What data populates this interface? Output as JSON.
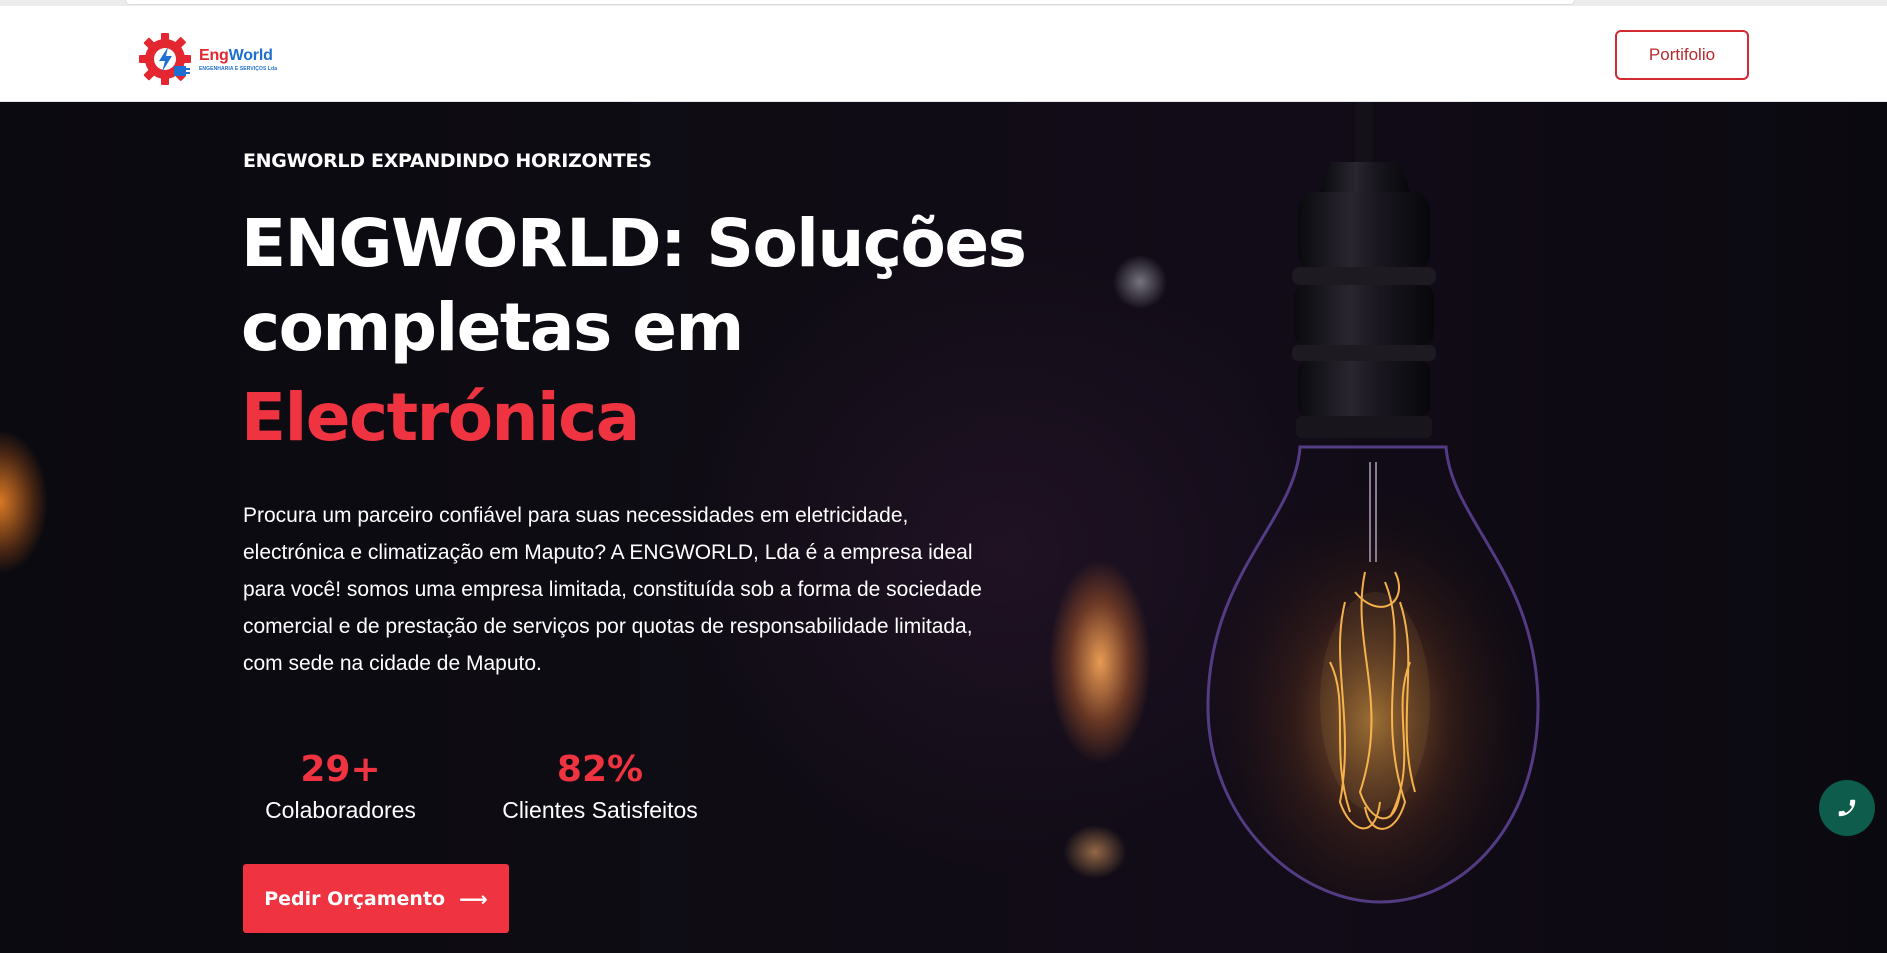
{
  "header": {
    "logo": {
      "name_part1": "Eng",
      "name_part2": "World",
      "tagline": "ENGENHARIA E SERVIÇOS Lda"
    },
    "portfolio_label": "Portifolio"
  },
  "hero": {
    "eyebrow": "ENGWORLD EXPANDINDO HORIZONTES",
    "title_line1": "ENGWORLD: Soluções",
    "title_line2": "completas em",
    "title_accent": "Electrónica",
    "description": "Procura um parceiro confiável para suas necessidades em eletricidade, electrónica  e climatização em Maputo? A ENGWORLD, Lda é a empresa ideal para você! somos uma empresa limitada, constituída sob a forma de sociedade comercial e de prestação de serviços por quotas de responsabilidade limitada, com sede na cidade de Maputo.",
    "stats": [
      {
        "value": "29+",
        "label": "Colaboradores"
      },
      {
        "value": "82%",
        "label": "Clientes Satisfeitos"
      }
    ],
    "cta_label": "Pedir Orçamento",
    "cta_arrow": "⟶"
  },
  "colors": {
    "accent": "#ef3340",
    "phone_bg": "#0e5c4b",
    "brand_blue": "#1e6fd1"
  },
  "icons": {
    "phone": "phone-icon",
    "arrow": "arrow-right-icon",
    "logo": "gear-plug-icon"
  }
}
